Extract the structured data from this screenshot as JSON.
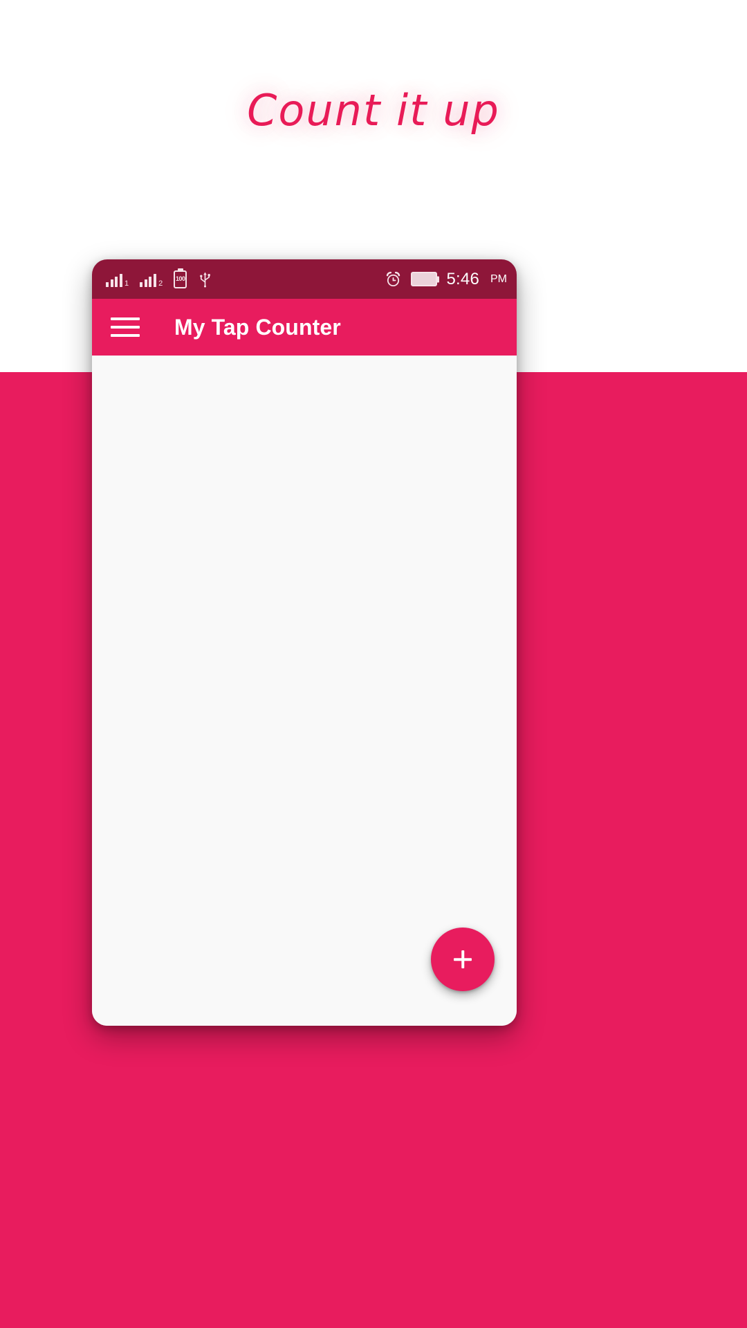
{
  "promo": {
    "headline": "Count it up",
    "accent_color": "#E81B57",
    "background_color": "#FFFFFF"
  },
  "backdrop": {
    "color": "#E81C5E"
  },
  "device": {
    "status_bar": {
      "background_color": "#8E1639",
      "left_icons": [
        {
          "name": "signal-bars-sim1-icon",
          "label": "1"
        },
        {
          "name": "signal-bars-sim2-icon",
          "label": "2"
        },
        {
          "name": "battery-percent-icon",
          "label": "100"
        },
        {
          "name": "usb-icon",
          "label": ""
        }
      ],
      "right_icons": [
        {
          "name": "alarm-clock-icon",
          "label": ""
        },
        {
          "name": "battery-full-icon",
          "label": ""
        }
      ],
      "time": "5:46",
      "am_pm": "PM"
    },
    "app_bar": {
      "background_color": "#E81C5E",
      "menu_icon": "hamburger-menu-icon",
      "title": "My Tap Counter"
    },
    "content": {
      "background_color": "#F9F9F9",
      "list_items": [],
      "fab": {
        "icon": "plus-icon",
        "label": "+",
        "color": "#E81C5E"
      }
    }
  }
}
